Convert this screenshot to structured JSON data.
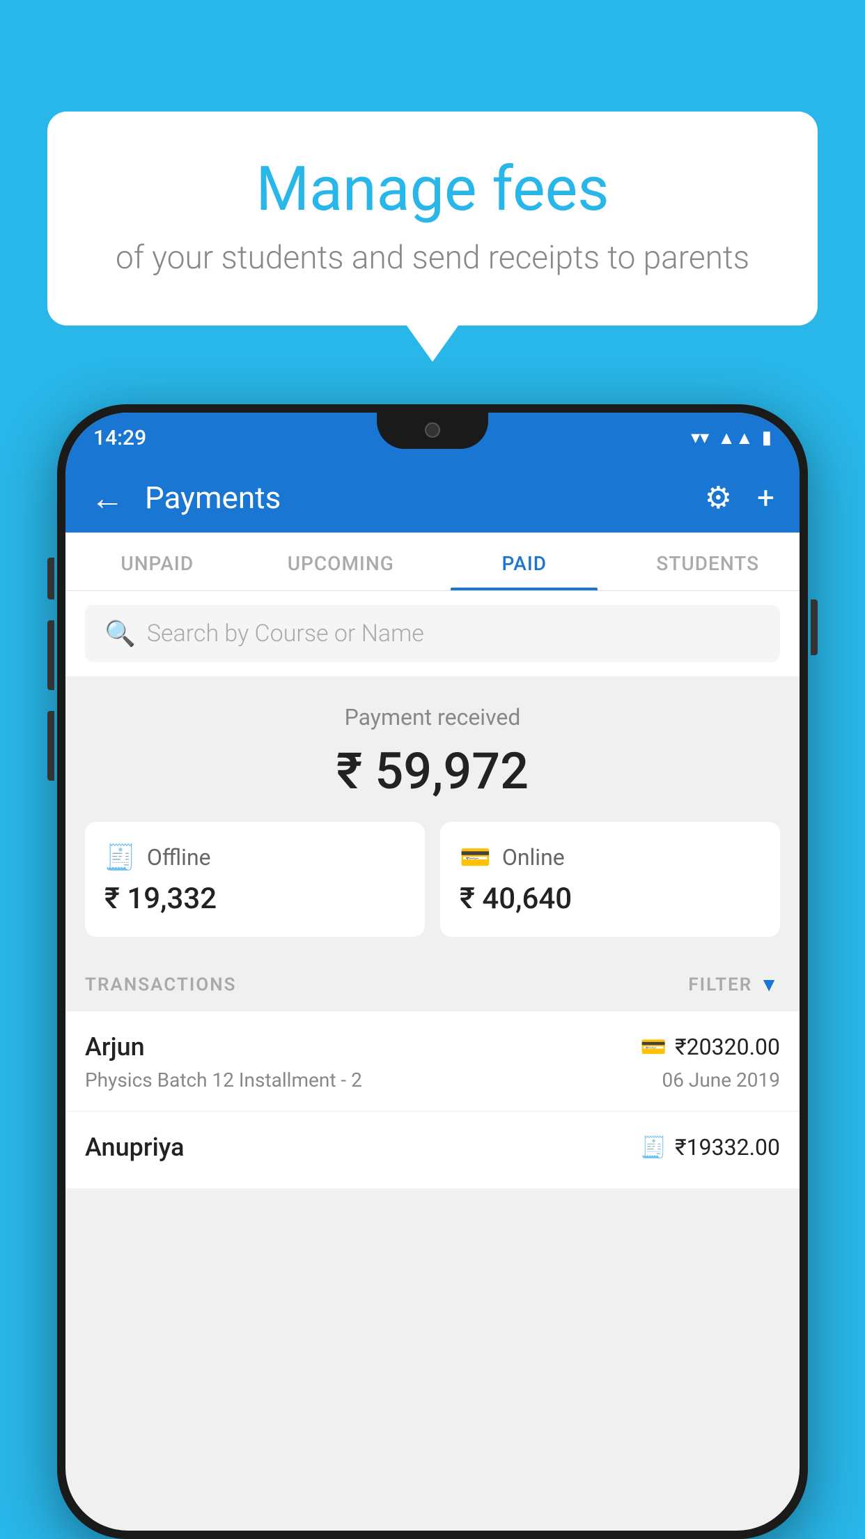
{
  "background_color": "#29b6e8",
  "speech_bubble": {
    "title": "Manage fees",
    "subtitle": "of your students and send receipts to parents"
  },
  "status_bar": {
    "time": "14:29",
    "wifi_icon": "▾",
    "signal_icon": "▲",
    "battery_icon": "▮"
  },
  "header": {
    "back_icon": "←",
    "title": "Payments",
    "gear_icon": "⚙",
    "plus_icon": "+"
  },
  "tabs": [
    {
      "label": "UNPAID",
      "active": false
    },
    {
      "label": "UPCOMING",
      "active": false
    },
    {
      "label": "PAID",
      "active": true
    },
    {
      "label": "STUDENTS",
      "active": false
    }
  ],
  "search": {
    "placeholder": "Search by Course or Name",
    "icon": "🔍"
  },
  "payment_summary": {
    "label": "Payment received",
    "amount": "₹ 59,972",
    "offline": {
      "label": "Offline",
      "amount": "₹ 19,332",
      "icon": "🧾"
    },
    "online": {
      "label": "Online",
      "amount": "₹ 40,640",
      "icon": "💳"
    }
  },
  "transactions": {
    "label": "TRANSACTIONS",
    "filter_label": "FILTER",
    "items": [
      {
        "name": "Arjun",
        "course": "Physics Batch 12 Installment - 2",
        "amount": "₹20320.00",
        "date": "06 June 2019",
        "icon": "💳"
      },
      {
        "name": "Anupriya",
        "course": "",
        "amount": "₹19332.00",
        "date": "",
        "icon": "🧾"
      }
    ]
  }
}
